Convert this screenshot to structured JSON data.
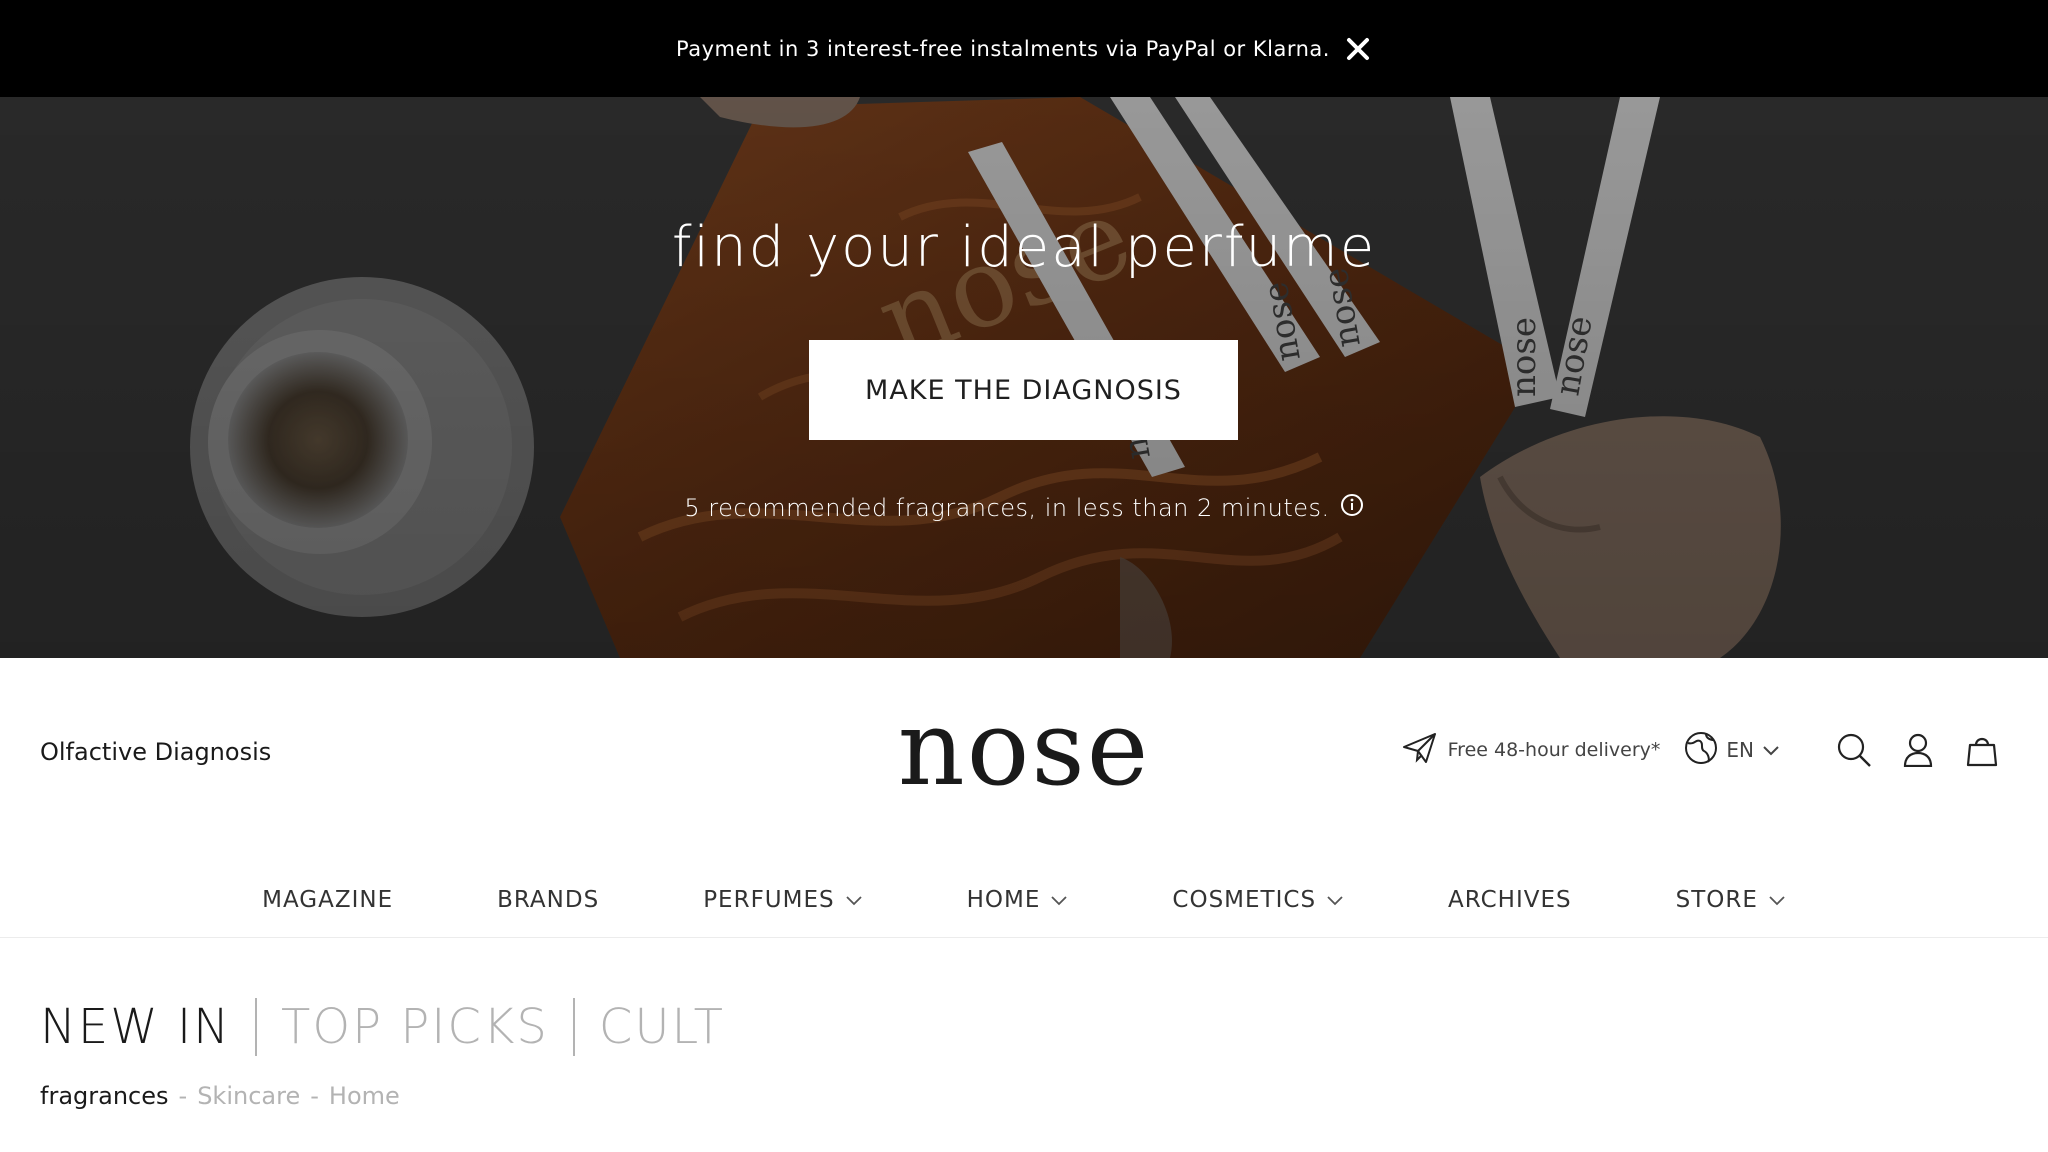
{
  "announcement": {
    "text": "Payment in 3 interest-free instalments via PayPal or Klarna."
  },
  "hero": {
    "title": "find your ideal perfume",
    "cta_label": "MAKE THE DIAGNOSIS",
    "subtitle": "5 recommended fragrances, in less than 2 minutes.",
    "image_text": {
      "logo": "nose",
      "strips": [
        "nose",
        "nose",
        "nose",
        "nose",
        "nose"
      ]
    }
  },
  "header": {
    "left_link": "Olfactive Diagnosis",
    "logo": "nose",
    "delivery": "Free 48-hour delivery*",
    "language": "EN"
  },
  "nav": {
    "items": [
      {
        "label": "MAGAZINE",
        "has_dropdown": false
      },
      {
        "label": "BRANDS",
        "has_dropdown": false
      },
      {
        "label": "PERFUMES",
        "has_dropdown": true
      },
      {
        "label": "HOME",
        "has_dropdown": true
      },
      {
        "label": "COSMETICS",
        "has_dropdown": true
      },
      {
        "label": "ARCHIVES",
        "has_dropdown": false
      },
      {
        "label": "STORE",
        "has_dropdown": true
      }
    ]
  },
  "tabs": {
    "items": [
      "NEW IN",
      "TOP PICKS",
      "CULT"
    ],
    "active": 0
  },
  "subtabs": {
    "items": [
      "fragrances",
      "Skincare",
      "Home"
    ],
    "active": 0,
    "separator": "-"
  },
  "colors": {
    "announce_bg": "#000000",
    "text_dark": "#1a1a1a",
    "text_muted": "#b3b3b3",
    "hero_cta_bg": "#ffffff"
  }
}
